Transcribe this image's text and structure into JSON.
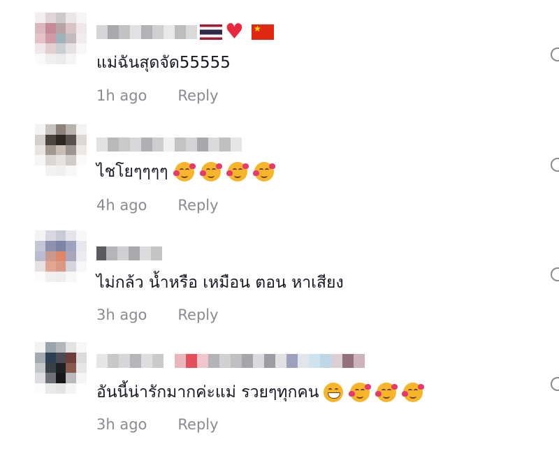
{
  "comments": [
    {
      "text": "แม่ฉันสุดจัด55555",
      "time": "1h ago",
      "reply": "Reply",
      "name_badges": [
        "thailand-flag",
        "red-heart",
        "china-flag"
      ],
      "emojis": []
    },
    {
      "text": "ไชโยๆๆๆๆ",
      "time": "4h ago",
      "reply": "Reply",
      "name_badges": [],
      "emojis": [
        "smiling-face-with-hearts",
        "smiling-face-with-hearts",
        "smiling-face-with-hearts",
        "smiling-face-with-hearts"
      ]
    },
    {
      "text": "ไม่กล้ว น้ำหรือ เหมือน ตอน หาเสียง",
      "time": "3h ago",
      "reply": "Reply",
      "name_badges": [],
      "emojis": []
    },
    {
      "text": "อันนี้น่ารักมากค่ะแม่ รวยๆทุกคน",
      "time": "3h ago",
      "reply": "Reply",
      "name_badges": [],
      "emojis": [
        "grinning-face",
        "smiling-face-with-hearts",
        "smiling-face-with-hearts",
        "smiling-face-with-hearts"
      ]
    }
  ]
}
